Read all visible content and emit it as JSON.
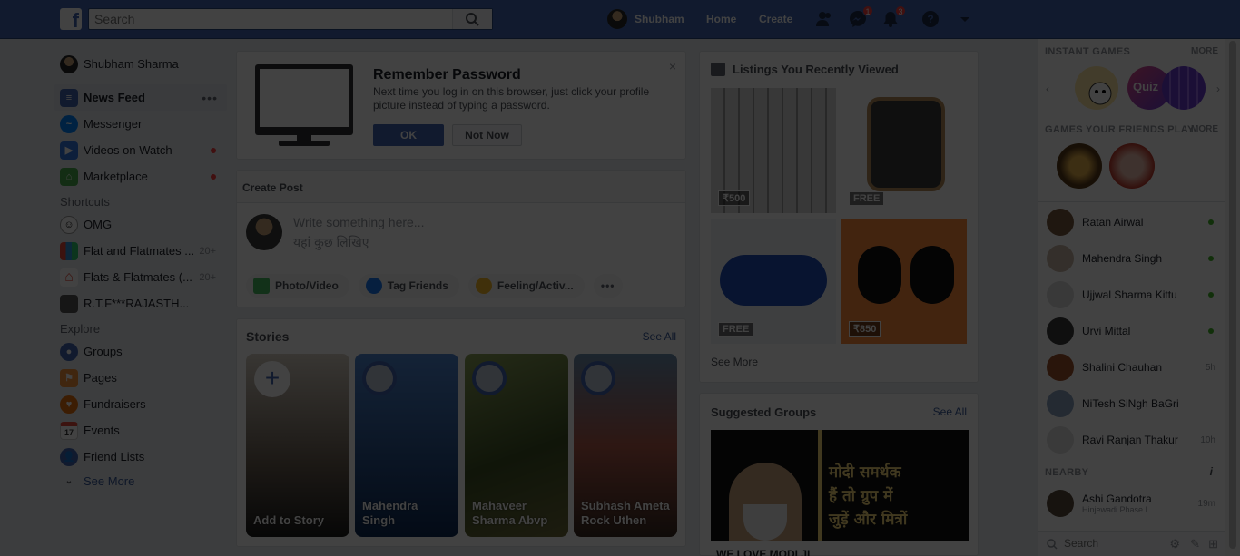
{
  "header": {
    "search_placeholder": "Search",
    "user_name": "Shubham",
    "home": "Home",
    "create": "Create",
    "messages_badge": "1",
    "notifications_badge": "3"
  },
  "sidebar": {
    "profile": "Shubham Sharma",
    "items": [
      {
        "label": "News Feed"
      },
      {
        "label": "Messenger"
      },
      {
        "label": "Videos on Watch"
      },
      {
        "label": "Marketplace"
      }
    ],
    "shortcuts_heading": "Shortcuts",
    "shortcuts": [
      {
        "label": "OMG",
        "count": ""
      },
      {
        "label": "Flat and Flatmates ...",
        "count": "20+"
      },
      {
        "label": "Flats & Flatmates (...",
        "count": "20+"
      },
      {
        "label": "R.T.F***RAJASTH...",
        "count": ""
      }
    ],
    "explore_heading": "Explore",
    "explore": [
      {
        "label": "Groups"
      },
      {
        "label": "Pages"
      },
      {
        "label": "Fundraisers"
      },
      {
        "label": "Events"
      },
      {
        "label": "Friend Lists"
      }
    ],
    "see_more": "See More"
  },
  "remember": {
    "title": "Remember Password",
    "desc": "Next time you log in on this browser, just click your profile picture instead of typing a password.",
    "ok": "OK",
    "not_now": "Not Now",
    "close": "×"
  },
  "create_post": {
    "heading": "Create Post",
    "placeholder_en": "Write something here...",
    "placeholder_hi": "यहां कुछ लिखिए",
    "photo": "Photo/Video",
    "tag": "Tag Friends",
    "feeling": "Feeling/Activ...",
    "more": "•••"
  },
  "stories": {
    "title": "Stories",
    "see_all": "See All",
    "items": [
      {
        "name": "Add to Story"
      },
      {
        "name": "Mahendra Singh"
      },
      {
        "name": "Mahaveer Sharma Abvp"
      },
      {
        "name": "Subhash Ameta Rock Uthen"
      }
    ]
  },
  "listings": {
    "title": "Listings You Recently Viewed",
    "prices": [
      "₹500",
      "FREE",
      "FREE",
      "₹850"
    ],
    "see_more": "See More"
  },
  "suggested": {
    "title": "Suggested Groups",
    "see_all": "See All",
    "image_text": [
      "मोदी समर्थक",
      "हैं तो ग्रुप में",
      "जुड़ें और मित्रों"
    ],
    "group_name": "WE LOVE MODI JI"
  },
  "chat": {
    "instant_games": "INSTANT GAMES",
    "more": "MORE",
    "quiz": "Quiz",
    "friends_games": "GAMES YOUR FRIENDS PLAY",
    "contacts": [
      {
        "name": "Ratan Airwal",
        "time": ""
      },
      {
        "name": "Mahendra Singh",
        "time": ""
      },
      {
        "name": "Ujjwal Sharma Kittu",
        "time": ""
      },
      {
        "name": "Urvi Mittal",
        "time": ""
      },
      {
        "name": "Shalini Chauhan",
        "time": "5h"
      },
      {
        "name": "NiTesh SiNgh BaGri",
        "time": ""
      },
      {
        "name": "Ravi Ranjan Thakur",
        "time": "10h"
      }
    ],
    "nearby": "NEARBY",
    "nearby_contact": {
      "name": "Ashi Gandotra",
      "sub": "Hinjewadi Phase I",
      "time": "19m"
    },
    "search_placeholder": "Search"
  }
}
